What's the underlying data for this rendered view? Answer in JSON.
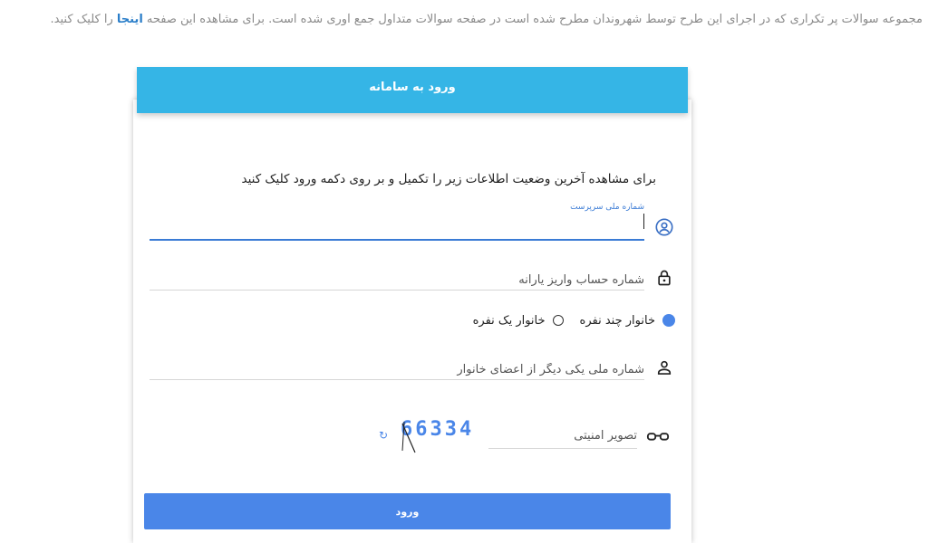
{
  "notice": {
    "text_before": "مجموعه سوالات پر تکراری که در اجرای این طرح توسط شهروندان مطرح شده است در صفحه سوالات متداول جمع آوری شده است. برای مشاهده این صفحه",
    "link": "اینجا",
    "text_after": "را کلیک کنید."
  },
  "login": {
    "title": "ورود به سامانه",
    "intro": "برای مشاهده آخرین وضعیت اطلاعات زیر را تکمیل و بر روی دکمه ورود کلیک کنید",
    "guardian_id_label": "شماره ملی سرپرست",
    "guardian_id_value": "",
    "account_placeholder": "شماره حساب واریز یارانه",
    "household_options": {
      "multi": "خانوار چند نفره",
      "single": "خانوار یک نفره"
    },
    "member_id_placeholder": "شماره ملی یکی دیگر از اعضای خانوار",
    "captcha_placeholder": "تصویر امنیتی",
    "captcha_code": "66334",
    "submit_label": "ورود"
  },
  "icons": {
    "guardian": "account-circle-icon",
    "account": "lock-icon",
    "member": "person-icon",
    "captcha": "glasses-icon",
    "refresh": "refresh-icon"
  },
  "colors": {
    "header": "#35b5e6",
    "primary": "#4a86e8",
    "link": "#2a7ec9"
  }
}
